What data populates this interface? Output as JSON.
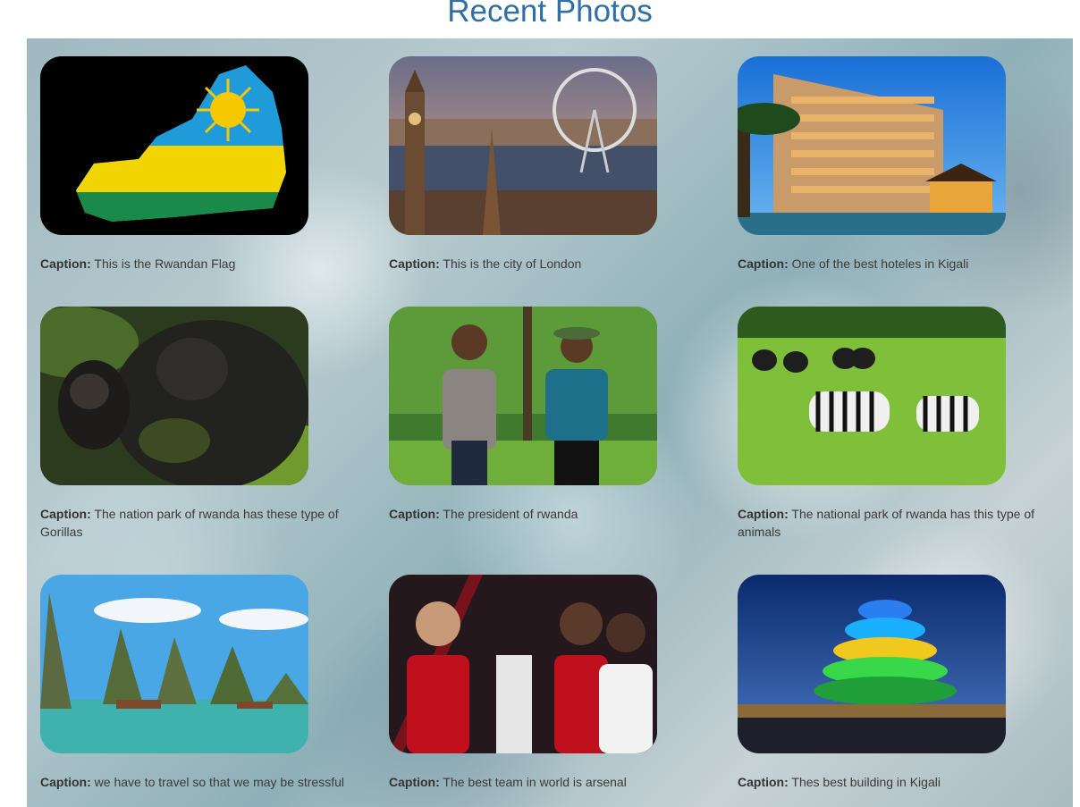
{
  "page_title": "Recent Photos",
  "caption_prefix": "Caption:",
  "photos": [
    {
      "caption": "This is the Rwandan Flag",
      "icon": "rwanda-flag-map-image"
    },
    {
      "caption": "This is the city of London",
      "icon": "london-city-image"
    },
    {
      "caption": "One of the best hoteles in Kigali",
      "icon": "kigali-hotel-image"
    },
    {
      "caption": "The nation park of rwanda has these type of Gorillas",
      "icon": "gorillas-image"
    },
    {
      "caption": "The president of rwanda",
      "icon": "president-walking-image"
    },
    {
      "caption": "The national park of rwanda has this type of animals",
      "icon": "zebras-buffalo-image"
    },
    {
      "caption": "we have to travel so that we may be stressful",
      "icon": "bay-islands-image"
    },
    {
      "caption": "The best team in world is arsenal",
      "icon": "arsenal-visit-rwanda-image"
    },
    {
      "caption": "Thes best building in Kigali",
      "icon": "kigali-convention-center-image"
    }
  ]
}
